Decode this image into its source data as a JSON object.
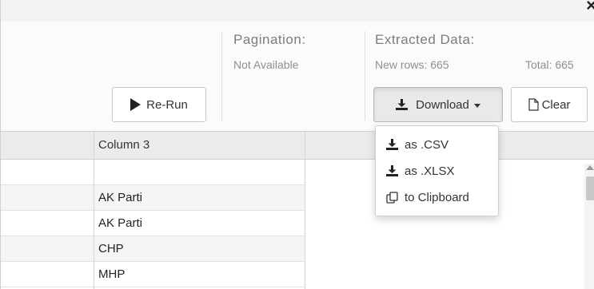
{
  "window": {
    "close_glyph": "×"
  },
  "pagination": {
    "title": "Pagination:",
    "value": "Not Available"
  },
  "extracted": {
    "title": "Extracted Data:",
    "new_rows": "New rows: 665",
    "total": "Total: 665"
  },
  "toolbar": {
    "rerun_label": "Re-Run",
    "download_label": "Download",
    "clear_label": "Clear"
  },
  "download_menu": {
    "items": [
      {
        "label": "as .CSV",
        "icon": "download-icon"
      },
      {
        "label": "as .XLSX",
        "icon": "download-icon"
      },
      {
        "label": "to Clipboard",
        "icon": "clipboard-icon"
      }
    ]
  },
  "table": {
    "columns": [
      "",
      "Column 3",
      ""
    ],
    "rows": [
      [
        ""
      ],
      [
        "AK Parti"
      ],
      [
        "AK Parti"
      ],
      [
        "CHP"
      ],
      [
        "MHP"
      ]
    ]
  }
}
